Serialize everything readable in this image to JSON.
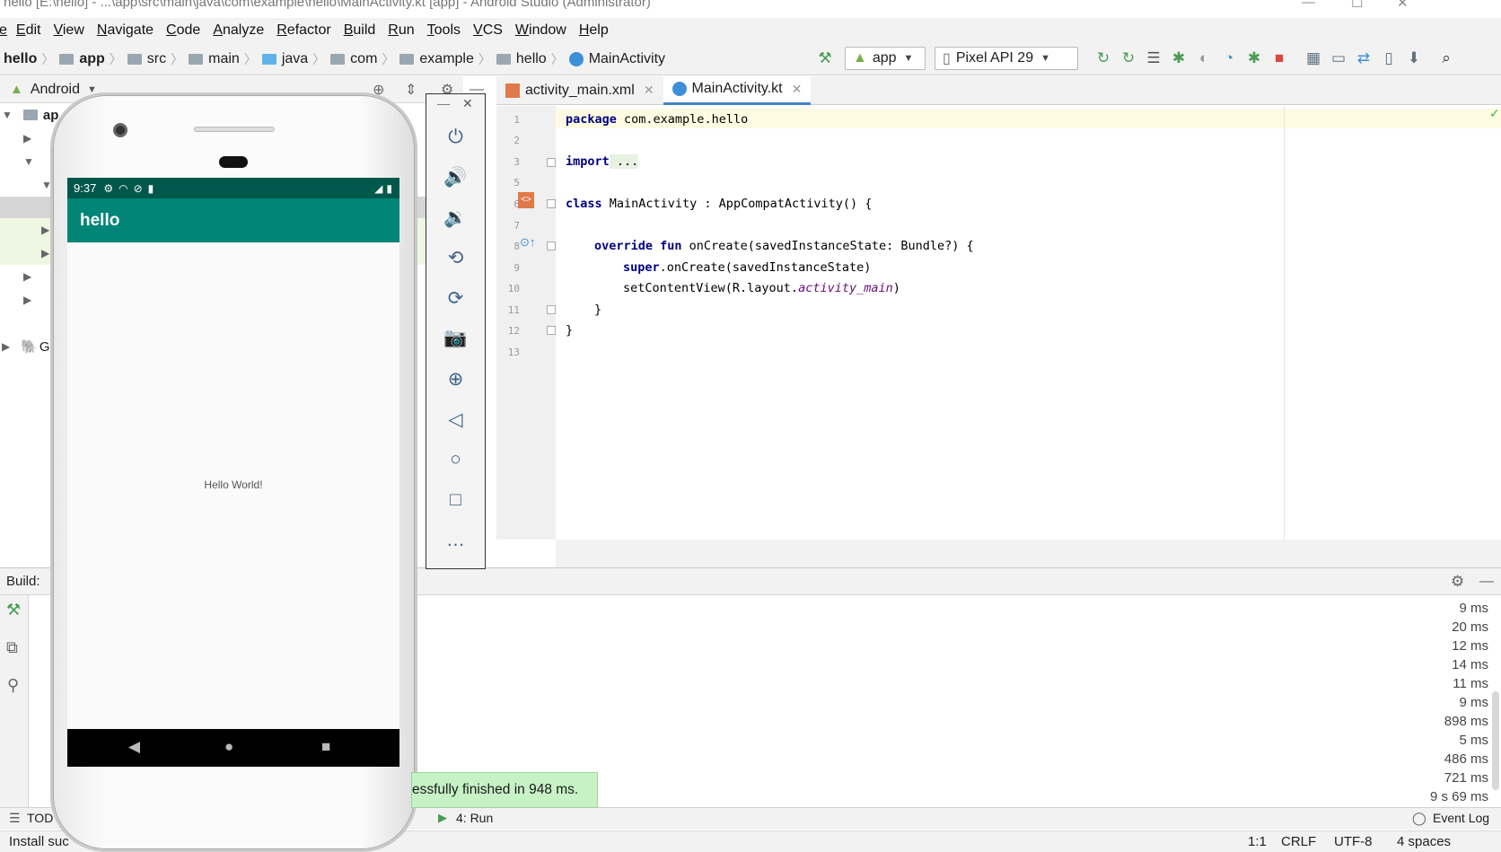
{
  "window": {
    "title": "hello [E:\\hello] - ...\\app\\src\\main\\java\\com\\example\\hello\\MainActivity.kt [app] - Android Studio (Administrator)"
  },
  "menu": [
    "Edit",
    "View",
    "Navigate",
    "Code",
    "Analyze",
    "Refactor",
    "Build",
    "Run",
    "Tools",
    "VCS",
    "Window",
    "Help"
  ],
  "menu_first": "e",
  "breadcrumbs": [
    "hello",
    "app",
    "src",
    "main",
    "java",
    "com",
    "example",
    "hello",
    "MainActivity"
  ],
  "run_config": "app",
  "device": "Pixel API 29",
  "project_view": "Android",
  "tree": {
    "root": "ap",
    "gradle_fragment": "G"
  },
  "editor": {
    "tabs": [
      "activity_main.xml",
      "MainActivity.kt"
    ],
    "active_tab": "MainActivity.kt",
    "line_numbers": [
      "1",
      "2",
      "3",
      "5",
      "6",
      "7",
      "8",
      "9",
      "10",
      "11",
      "12",
      "13"
    ],
    "code": {
      "l1_kw": "package",
      "l1_rest": " com.example.hello",
      "l3_kw": "import",
      "l3_rest": " ...",
      "l6_kw": "class",
      "l6_rest": " MainActivity : AppCompatActivity() {",
      "l8_kw": "override fun",
      "l8_rest": " onCreate(savedInstanceState: Bundle?) {",
      "l9_kw": "super",
      "l9_rest": ".onCreate(savedInstanceState)",
      "l10_pre": "setContentView(R.layout.",
      "l10_it": "activity_main",
      "l10_post": ")",
      "l11": "}",
      "l12": "}"
    }
  },
  "build": {
    "label": "Build:",
    "timings": [
      "9 ms",
      "20 ms",
      "12 ms",
      "14 ms",
      "11 ms",
      "9 ms",
      "898 ms",
      "5 ms",
      "486 ms",
      "721 ms",
      "9 s 69 ms"
    ]
  },
  "toast": "essfully finished in 948 ms.",
  "bottom": {
    "todo": "TOD",
    "run": "4: Run",
    "event_log": "Event Log"
  },
  "status": {
    "left": "Install suc",
    "position": "1:1",
    "line_sep": "CRLF",
    "encoding": "UTF-8",
    "indent": "4 spaces"
  },
  "phone": {
    "time": "9:37",
    "app_title": "hello",
    "content": "Hello World!",
    "colors": {
      "status": "#00574b",
      "appbar": "#008577"
    }
  },
  "emulator_tools": [
    "power-icon",
    "volume-up-icon",
    "volume-down-icon",
    "rotate-left-icon",
    "rotate-right-icon",
    "camera-icon",
    "zoom-icon",
    "back-icon",
    "home-icon",
    "overview-icon",
    "more-icon"
  ]
}
